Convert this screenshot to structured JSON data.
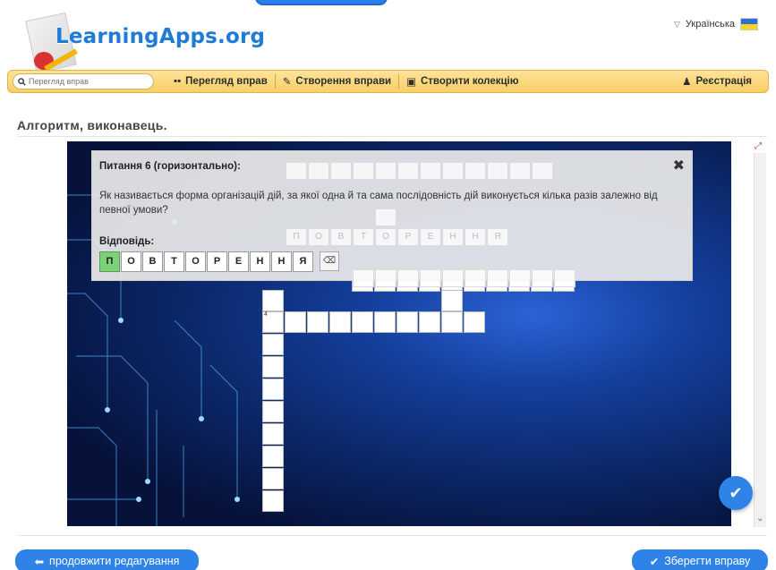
{
  "header": {
    "logo_text": "LearningApps.org",
    "language": "Українська"
  },
  "nav": {
    "search_placeholder": "Перегляд вправ",
    "browse": "Перегляд вправ",
    "create": "Створення вправи",
    "collection": "Створити колекцію",
    "register": "Реєстрація"
  },
  "page": {
    "title": "Алгоритм, виконавець."
  },
  "question": {
    "title": "Питання 6 (горизонтально):",
    "text": "Як називається форма організацій дій, за якої одна й та сама послідовність дій виконується кілька разів залежно від певної умови?",
    "answer_label": "Відповідь:",
    "answer_letters": [
      "П",
      "О",
      "В",
      "Т",
      "О",
      "Р",
      "Е",
      "Н",
      "Н",
      "Я"
    ],
    "ghost_letters": [
      "П",
      "О",
      "В",
      "Т",
      "О",
      "Р",
      "Е",
      "Н",
      "Н",
      "Я"
    ],
    "backspace": "⌫"
  },
  "grid": {
    "clue_number": "4"
  },
  "footer": {
    "continue_label": "продовжити редагування",
    "save_label": "Зберегти вправу"
  },
  "colors": {
    "accent": "#2f82e6",
    "navbar": "#f6cf65",
    "active_cell": "#7dd279"
  }
}
